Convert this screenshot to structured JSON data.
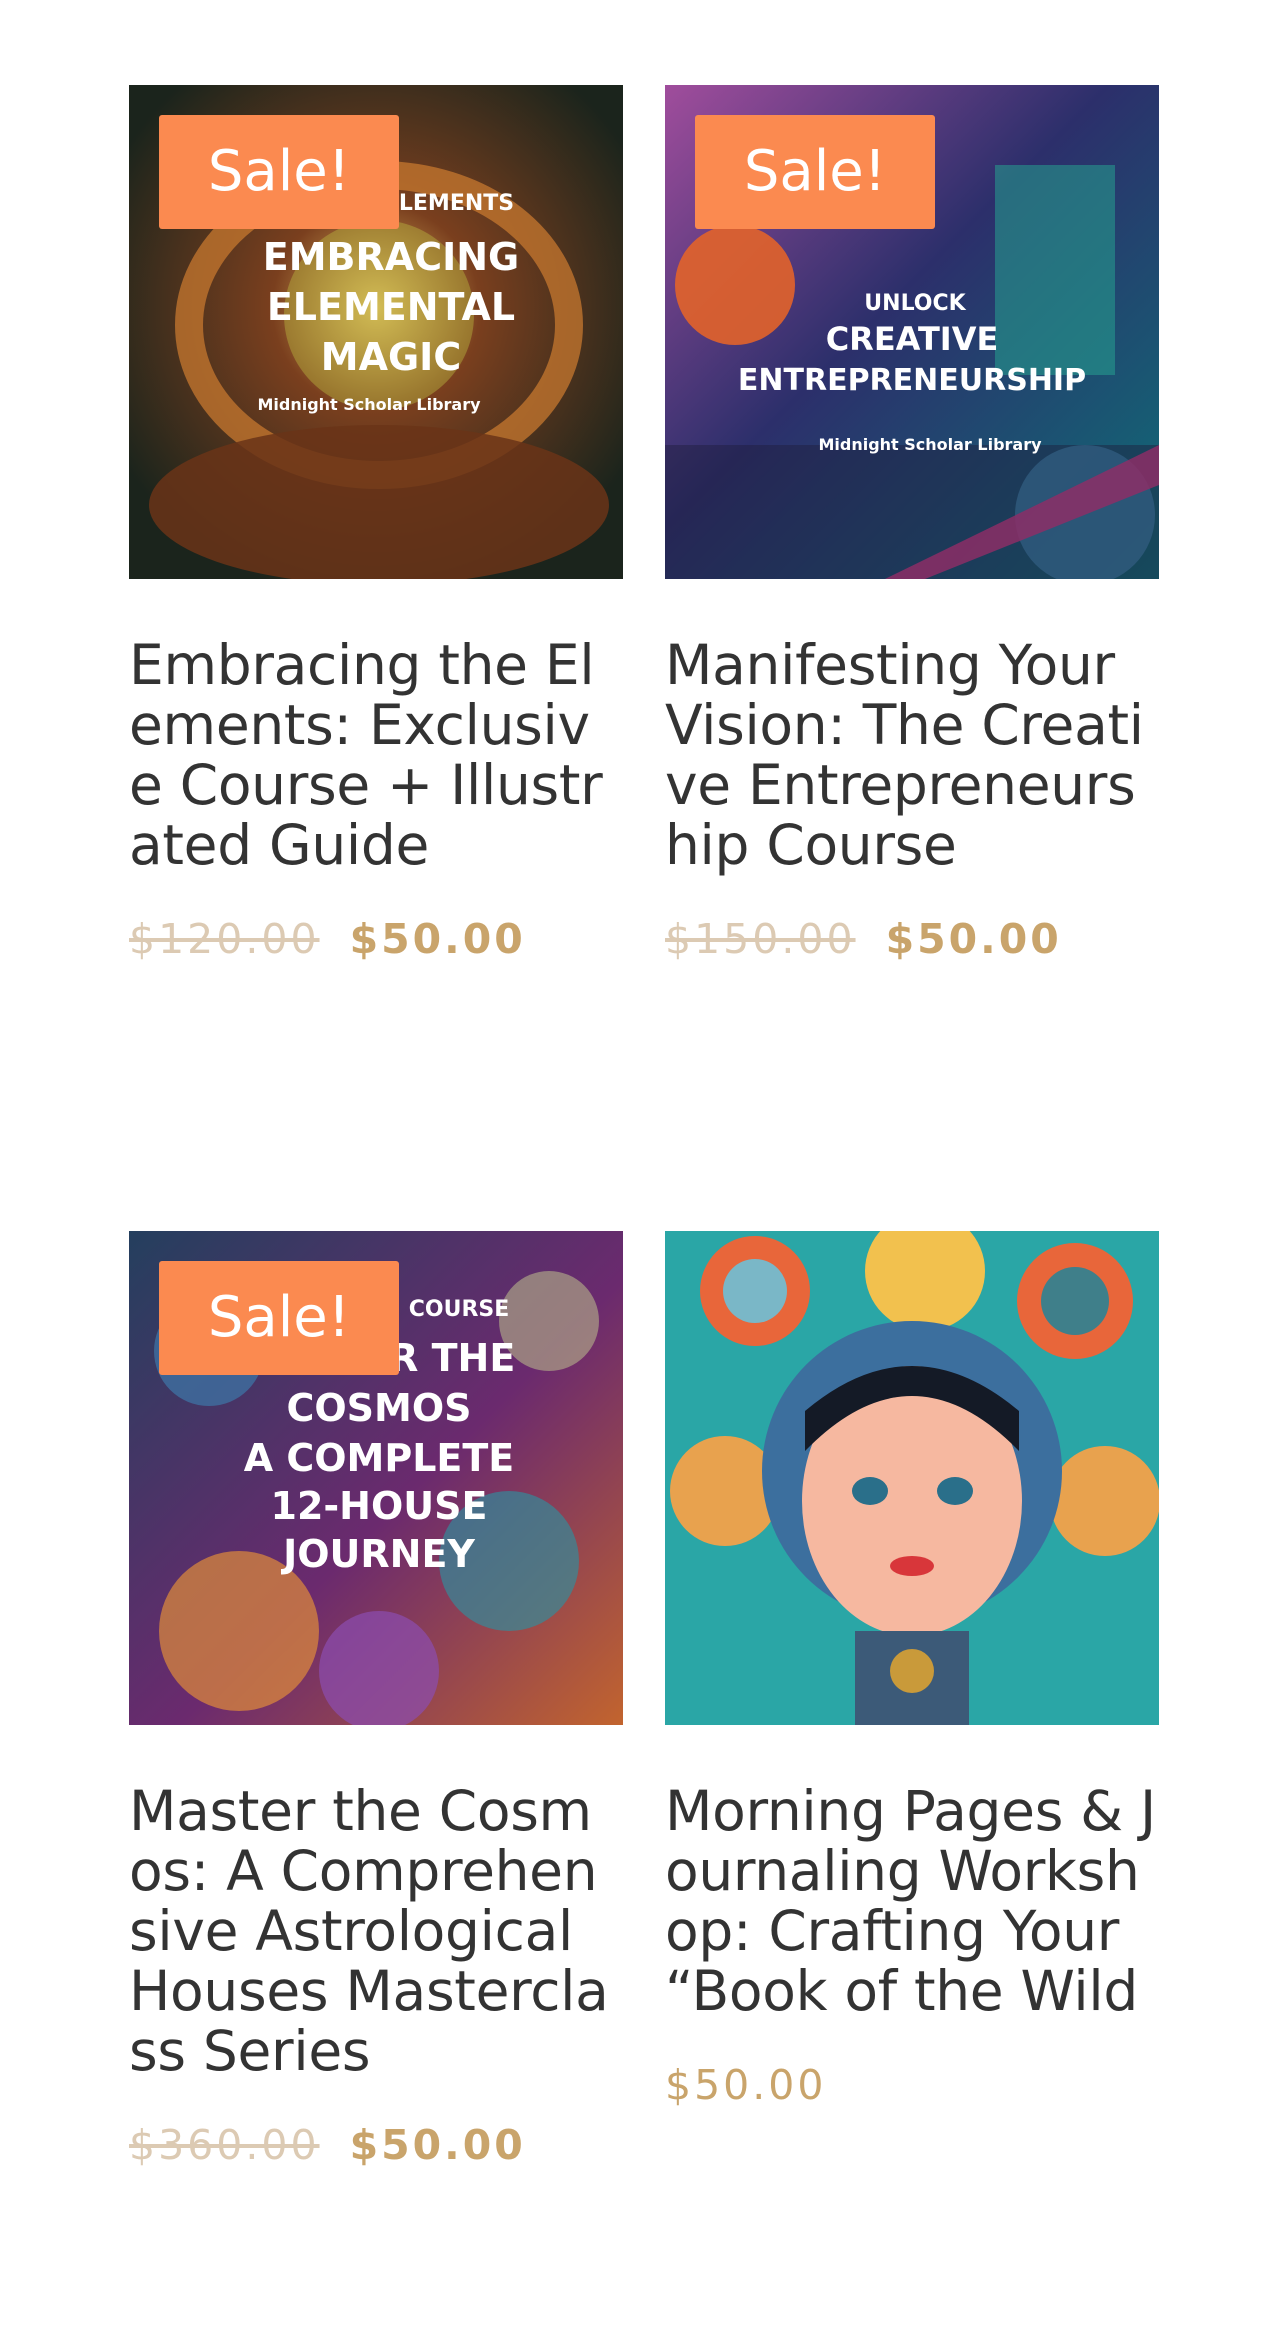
{
  "products": [
    {
      "badge": "Sale!",
      "title": "Embracing the Elements: Exclusive Course + Illustrated Guide",
      "old_price": "$120.00",
      "price": "$50.00",
      "cover": {
        "top_line": "ELEMENTS",
        "lines": [
          "EMBRACING",
          "ELEMENTAL",
          "MAGIC"
        ],
        "publisher": "Midnight Scholar Library",
        "colors": [
          "#1f2a1f",
          "#8a4a24",
          "#d9a45a"
        ]
      }
    },
    {
      "badge": "Sale!",
      "title": "Manifesting Your Vision: The Creative Entrepreneurship Course",
      "old_price": "$150.00",
      "price": "$50.00",
      "cover": {
        "top_line": "UNLOCK",
        "lines": [
          "CREATIVE",
          "ENTREPRENEURSHIP"
        ],
        "publisher": "Midnight Scholar Library",
        "colors": [
          "#2b2a5c",
          "#c2338f",
          "#1c8f8a"
        ]
      }
    },
    {
      "badge": "Sale!",
      "title": "Master the Cosmos: A Comprehensive Astrological Houses Masterclass Series",
      "old_price": "$360.00",
      "price": "$50.00",
      "cover": {
        "top_line": "COURSE",
        "lines": [
          "MASTER THE",
          "COSMOS",
          "A COMPLETE",
          "12-HOUSE",
          "JOURNEY"
        ],
        "colors": [
          "#1d3550",
          "#8a2f7a",
          "#d9752f"
        ]
      }
    },
    {
      "badge": "",
      "title": "Morning Pages & Journaling Workshop: Crafting Your “Book of the Wild",
      "old_price": "",
      "price": "$50.00",
      "cover": {
        "colors": [
          "#2aa6a6",
          "#e8663a",
          "#f2c14e"
        ]
      }
    }
  ],
  "colors": {
    "sale_badge": "#fb8a50",
    "price": "#c9a46b",
    "old_price": "#dccab3",
    "title": "#333333"
  }
}
